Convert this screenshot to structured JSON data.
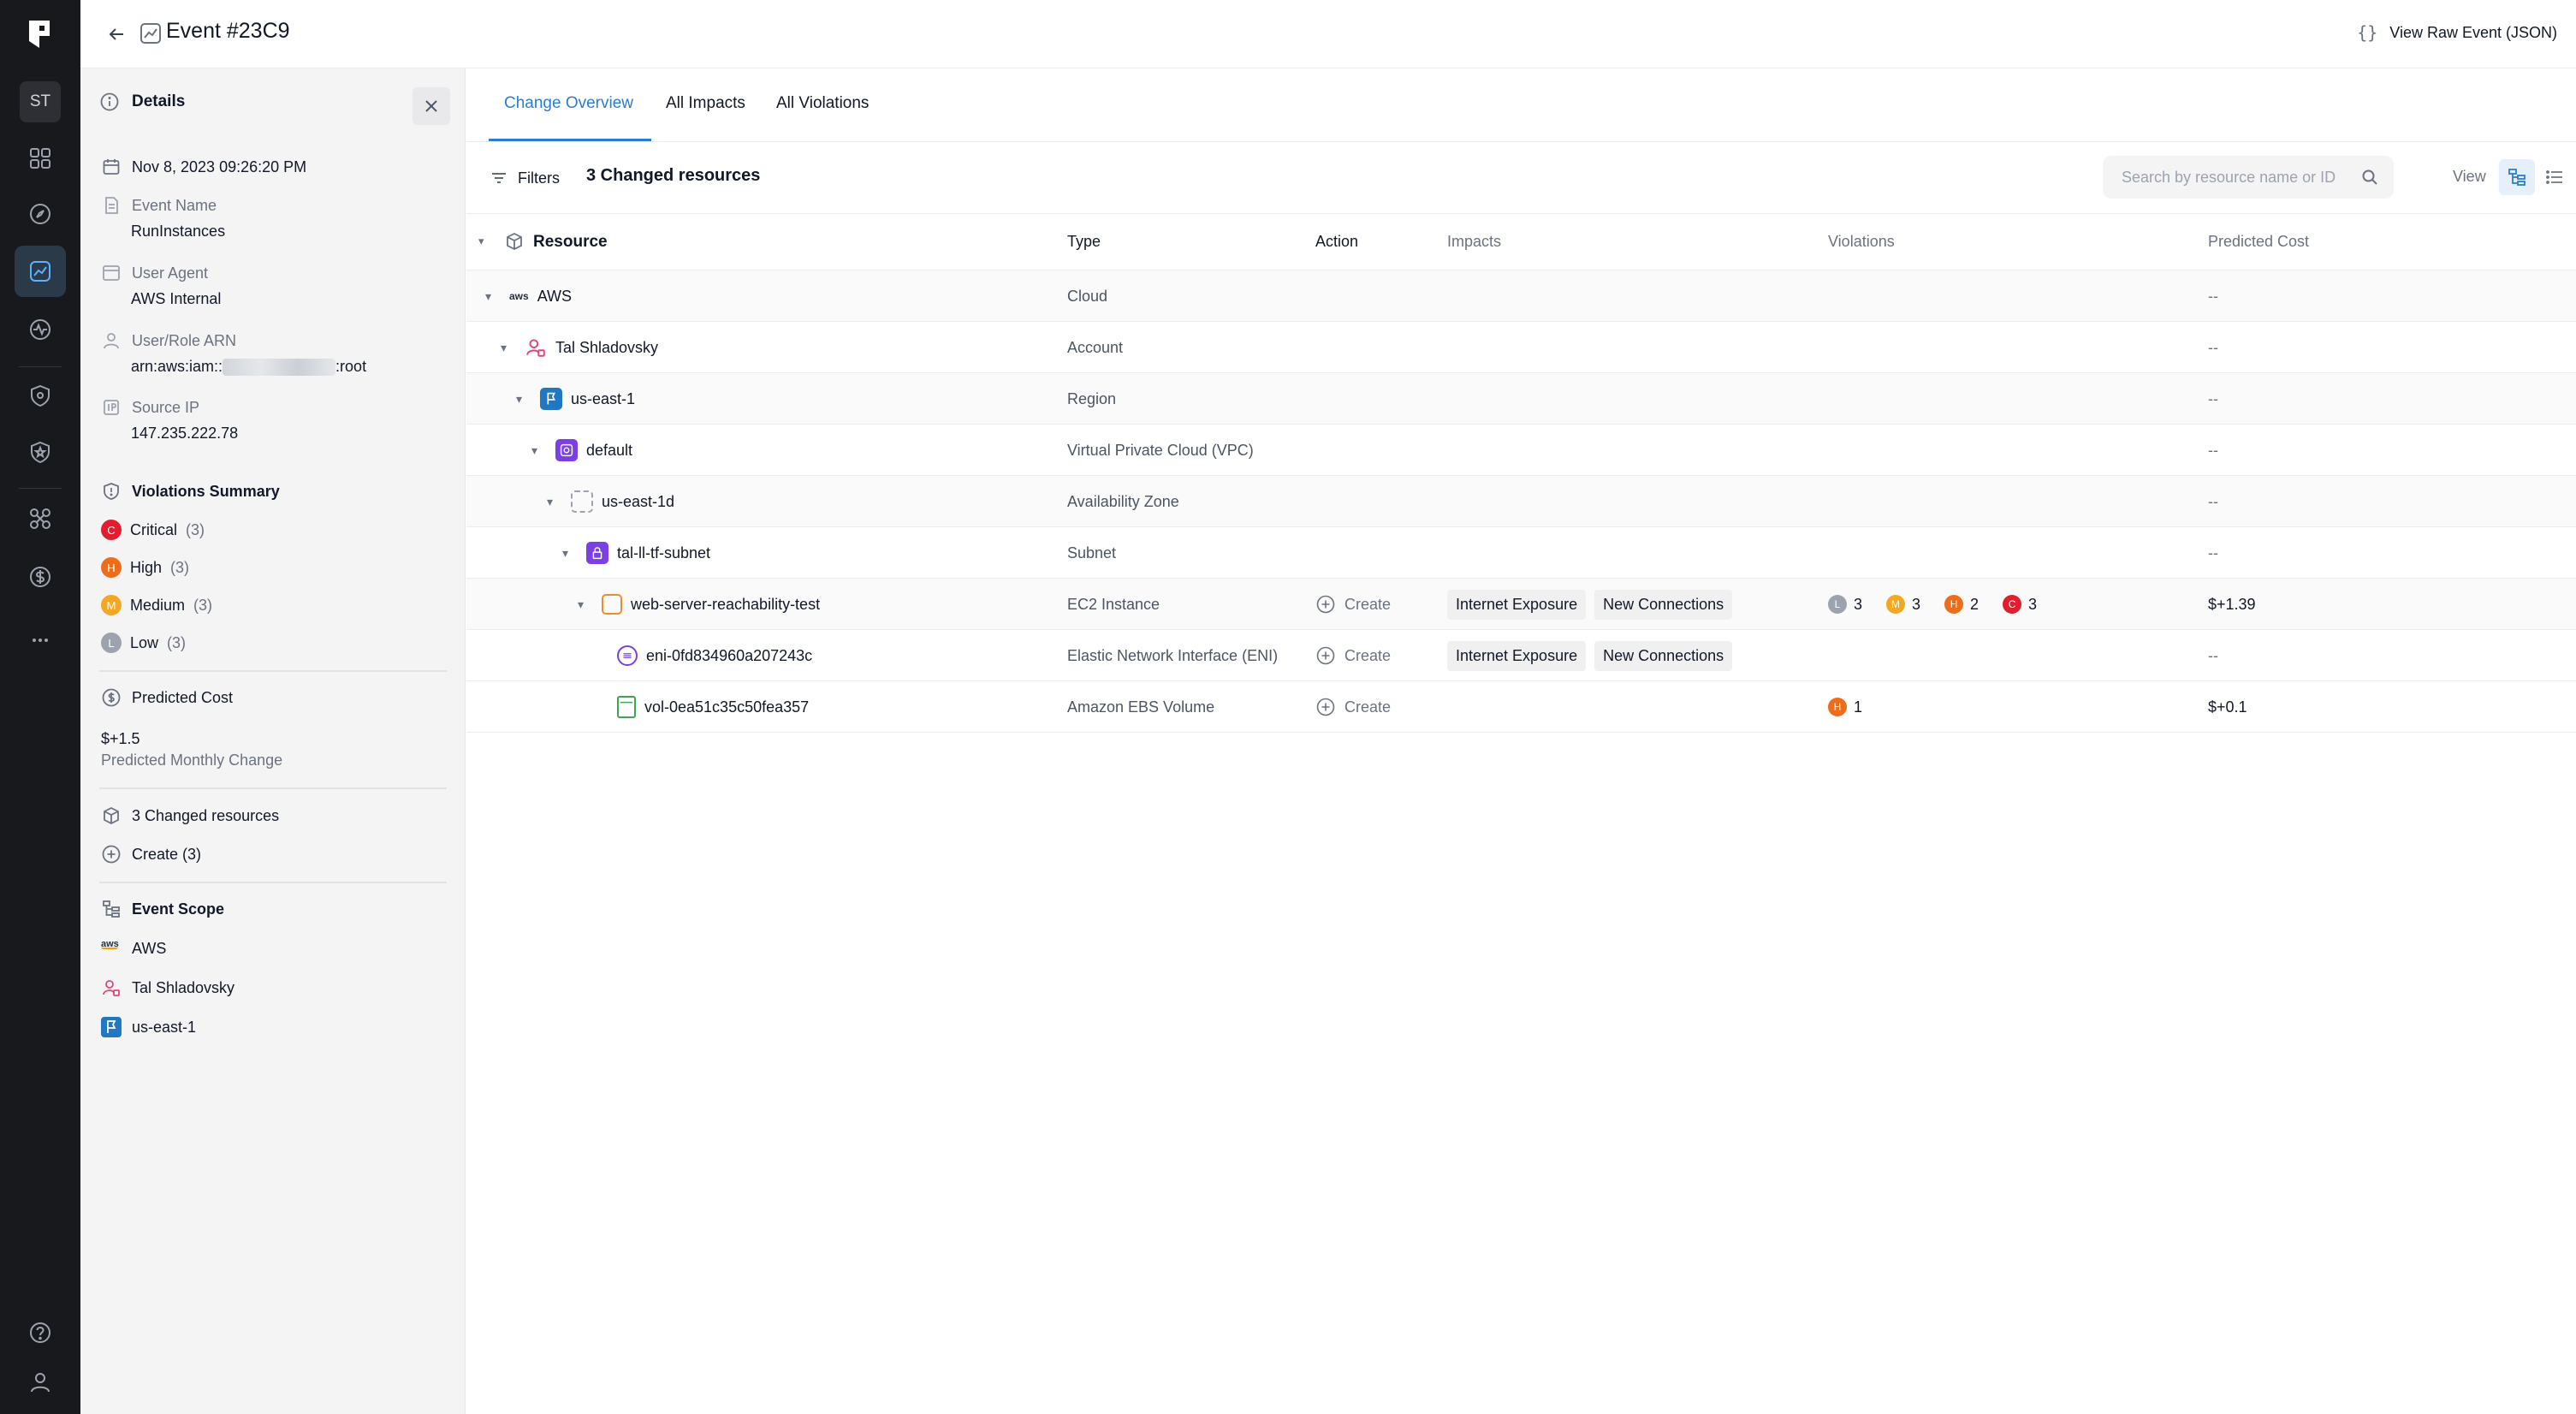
{
  "header": {
    "title": "Event #23C9",
    "raw_link": "View Raw Event (JSON)"
  },
  "rail": {
    "avatar": "ST"
  },
  "details": {
    "heading": "Details",
    "date": "Nov 8, 2023 09:26:20 PM",
    "event_name_label": "Event Name",
    "event_name": "RunInstances",
    "user_agent_label": "User Agent",
    "user_agent": "AWS Internal",
    "user_role_label": "User/Role ARN",
    "arn_prefix": "arn:aws:iam::",
    "arn_suffix": ":root",
    "source_ip_label": "Source IP",
    "source_ip": "147.235.222.78",
    "violations_title": "Violations Summary",
    "violations": [
      {
        "badge": "C",
        "label": "Critical",
        "count": "(3)",
        "color": "#e11d2e"
      },
      {
        "badge": "H",
        "label": "High",
        "count": "(3)",
        "color": "#ef6c1a"
      },
      {
        "badge": "M",
        "label": "Medium",
        "count": "(3)",
        "color": "#f5a623"
      },
      {
        "badge": "L",
        "label": "Low",
        "count": "(3)",
        "color": "#9ca3af"
      }
    ],
    "predicted_cost_title": "Predicted Cost",
    "predicted_cost_value": "$+1.5",
    "predicted_cost_sub": "Predicted Monthly Change",
    "changed_title": "3 Changed resources",
    "changed_create": "Create (3)",
    "scope_title": "Event Scope",
    "scope": [
      "AWS",
      "Tal Shladovsky",
      "us-east-1"
    ]
  },
  "tabs": [
    "Change Overview",
    "All Impacts",
    "All Violations"
  ],
  "toolbar": {
    "filters": "Filters",
    "changed": "3 Changed resources",
    "search_placeholder": "Search by resource name or ID",
    "view_label": "View"
  },
  "table": {
    "headers": {
      "resource": "Resource",
      "type": "Type",
      "action": "Action",
      "impacts": "Impacts",
      "violations": "Violations",
      "cost": "Predicted Cost"
    },
    "rows": [
      {
        "name": "AWS",
        "type": "Cloud",
        "cost": "--"
      },
      {
        "name": "Tal Shladovsky",
        "type": "Account",
        "cost": "--"
      },
      {
        "name": "us-east-1",
        "type": "Region",
        "cost": "--"
      },
      {
        "name": "default",
        "type": "Virtual Private Cloud (VPC)",
        "cost": "--"
      },
      {
        "name": "us-east-1d",
        "type": "Availability Zone",
        "cost": "--"
      },
      {
        "name": "tal-ll-tf-subnet",
        "type": "Subnet",
        "cost": "--"
      },
      {
        "name": "web-server-reachability-test",
        "type": "EC2 Instance",
        "action": "Create",
        "impacts": [
          "Internet Exposure",
          "New Connections"
        ],
        "violations": [
          {
            "badge": "L",
            "count": "3"
          },
          {
            "badge": "M",
            "count": "3"
          },
          {
            "badge": "H",
            "count": "2"
          },
          {
            "badge": "C",
            "count": "3"
          }
        ],
        "cost": "$+1.39"
      },
      {
        "name": "eni-0fd834960a207243c",
        "type": "Elastic Network Interface (ENI)",
        "action": "Create",
        "impacts": [
          "Internet Exposure",
          "New Connections"
        ],
        "cost": "--"
      },
      {
        "name": "vol-0ea51c35c50fea357",
        "type": "Amazon EBS Volume",
        "action": "Create",
        "violations": [
          {
            "badge": "H",
            "count": "1"
          }
        ],
        "cost": "$+0.1"
      }
    ]
  }
}
